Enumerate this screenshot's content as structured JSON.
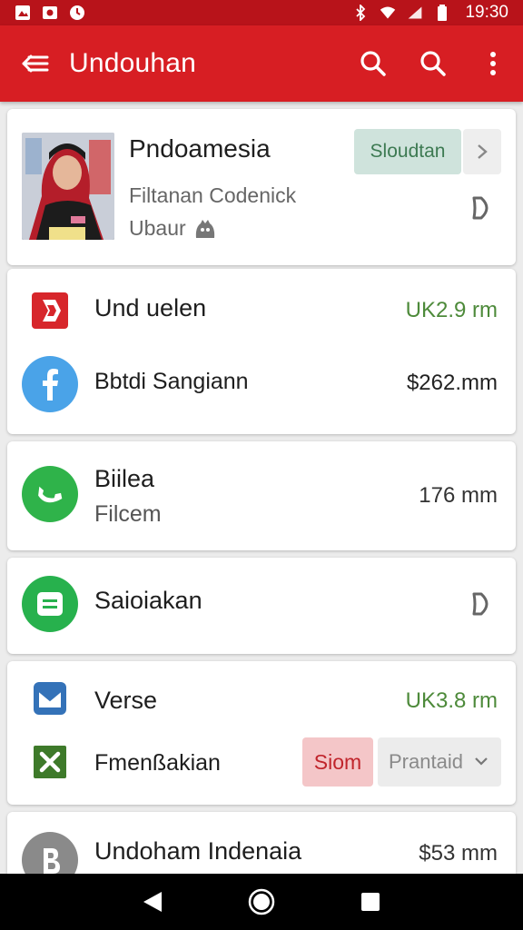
{
  "status_bar": {
    "time": "19:30"
  },
  "app_bar": {
    "title": "Undouhan"
  },
  "card_profile": {
    "name": "Pndoamesia",
    "subtitle": "Filtanan Codenick",
    "location": "Ubaur",
    "button_primary": "Sloudtan",
    "button_secondary": ">"
  },
  "card_transactions": {
    "items": [
      {
        "label": "Und uelen",
        "value": "UK2.9 rm",
        "icon": "red-bookmark-icon"
      },
      {
        "label": "Bbtdi Sangiann",
        "value": "$262.mm",
        "icon": "facebook-icon"
      }
    ]
  },
  "card_file": {
    "label": "Biilea",
    "sub": "Filcem",
    "value": "176 mm",
    "icon": "green-phone-icon"
  },
  "card_saving": {
    "label": "Saioiakan",
    "icon": "green-list-icon"
  },
  "card_verse": {
    "items": [
      {
        "label": "Verse",
        "value": "UK3.8 rm",
        "icon": "blue-mail-icon"
      },
      {
        "label": "Fmenßakian",
        "icon": "green-x-icon"
      }
    ],
    "button_red": "Siom",
    "select_value": "Prantaid"
  },
  "card_last": {
    "label": "Undoham Indenaia",
    "value": "$53 mm",
    "icon": "grey-b-icon"
  },
  "colors": {
    "primary": "#d71e23",
    "statusbar": "#b8131a",
    "green": "#4d8a3a"
  }
}
